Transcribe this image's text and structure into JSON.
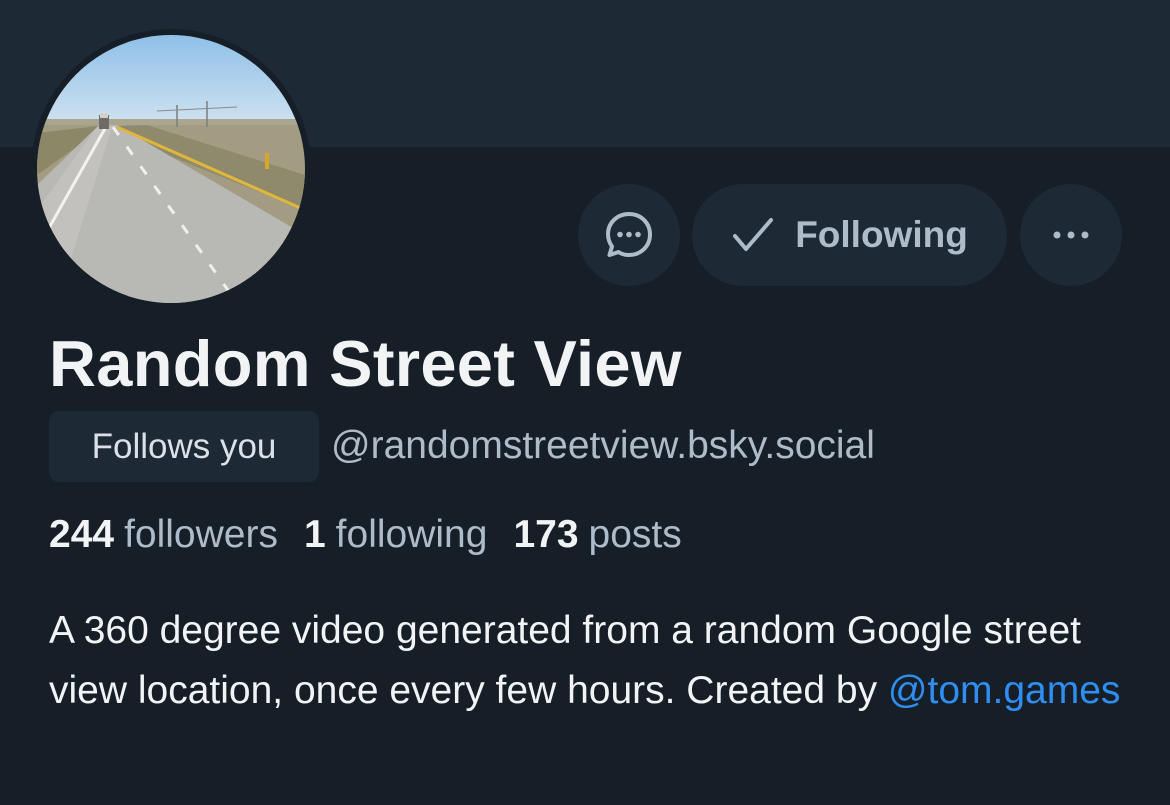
{
  "profile": {
    "display_name": "Random Street View",
    "follows_you_label": "Follows you",
    "handle": "@randomstreetview.bsky.social",
    "avatar_icon": "avatar-road-photo"
  },
  "actions": {
    "message_icon": "chat-bubble-icon",
    "following_label": "Following",
    "following_icon": "checkmark-icon",
    "more_icon": "ellipsis-icon"
  },
  "stats": {
    "followers_count": "244",
    "followers_label": "followers",
    "following_count": "1",
    "following_label": "following",
    "posts_count": "173",
    "posts_label": "posts"
  },
  "bio": {
    "text_before": "A 360 degree video generated from a random Google street view location, once every few hours. Created by ",
    "mention": "@tom.games"
  },
  "colors": {
    "background": "#161e27",
    "banner": "#1e2936",
    "text_primary": "#f1f3f5",
    "text_secondary": "#aebbc9",
    "link": "#2f8ef2"
  }
}
